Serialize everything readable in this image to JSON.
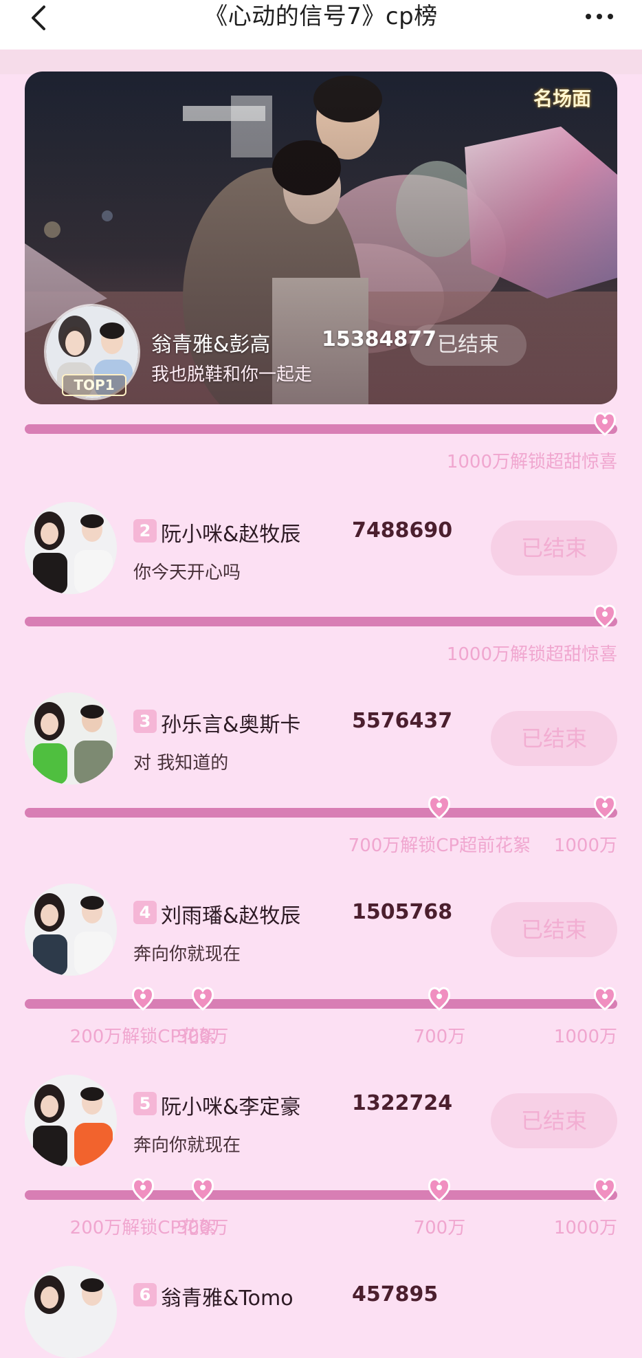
{
  "header": {
    "title": "《心动的信号7》cp榜",
    "back_icon": "back-chevron-icon",
    "more_icon": "more-dots-icon"
  },
  "colors": {
    "page_bg": "#fce0f3",
    "track": "#d87eb4",
    "heart": "#f08fc0",
    "label": "#f0a6cf",
    "button_bg": "#f7d0e6",
    "button_text": "#f2aed2"
  },
  "hero": {
    "badge": "名场面",
    "top_label": "TOP1",
    "name": "翁青雅&彭高",
    "score": "15384877",
    "line": "我也脱鞋和你一起走",
    "button": "已结束",
    "progress": {
      "milestones": [
        {
          "text": "1000万解锁超甜惊喜",
          "value_wan": 1000
        }
      ]
    }
  },
  "rows": [
    {
      "rank": "2",
      "name": "阮小咪&赵牧辰",
      "score": "7488690",
      "line": "你今天开心吗",
      "button": "已结束",
      "milestones": [
        {
          "text": "1000万解锁超甜惊喜",
          "value_wan": 1000
        }
      ]
    },
    {
      "rank": "3",
      "name": "孙乐言&奥斯卡",
      "score": "5576437",
      "line": "对 我知道的",
      "button": "已结束",
      "milestones": [
        {
          "text": "700万解锁CP超前花絮",
          "value_wan": 700
        },
        {
          "text": "1000万",
          "value_wan": 1000
        }
      ]
    },
    {
      "rank": "4",
      "name": "刘雨璠&赵牧辰",
      "score": "1505768",
      "line": "奔向你就现在",
      "button": "已结束",
      "milestones": [
        {
          "text": "200万解锁CP花絮",
          "value_wan": 200
        },
        {
          "text": "300万",
          "value_wan": 300
        },
        {
          "text": "700万",
          "value_wan": 700
        },
        {
          "text": "1000万",
          "value_wan": 1000
        }
      ]
    },
    {
      "rank": "5",
      "name": "阮小咪&李定豪",
      "score": "1322724",
      "line": "奔向你就现在",
      "button": "已结束",
      "milestones": [
        {
          "text": "200万解锁CP花絮",
          "value_wan": 200
        },
        {
          "text": "300万",
          "value_wan": 300
        },
        {
          "text": "700万",
          "value_wan": 700
        },
        {
          "text": "1000万",
          "value_wan": 1000
        }
      ]
    },
    {
      "rank": "6",
      "name": "翁青雅&Tomo",
      "score": "457895"
    }
  ]
}
